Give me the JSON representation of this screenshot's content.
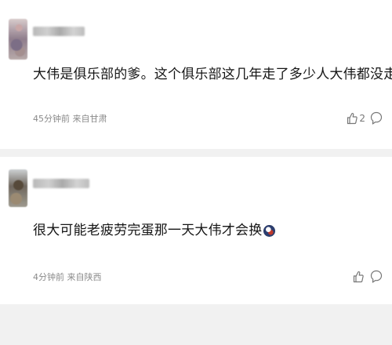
{
  "comments": [
    {
      "username": "",
      "text": "大伟是俱乐部的爹。这个俱乐部这几年走了多少人大伟都没走",
      "emoji": "laugh-cry-emoji",
      "time_ago": "45分钟前",
      "location": "来自甘肃",
      "like_count": "2"
    },
    {
      "username": "",
      "text": "很大可能老疲劳完蛋那一天大伟才会换",
      "emoji": "football-emoji",
      "time_ago": "4分钟前",
      "location": "来自陕西",
      "like_count": ""
    }
  ],
  "colors": {
    "background": "#f1f1f1",
    "card": "#ffffff",
    "text": "#151515",
    "meta": "#8a8a8a"
  }
}
